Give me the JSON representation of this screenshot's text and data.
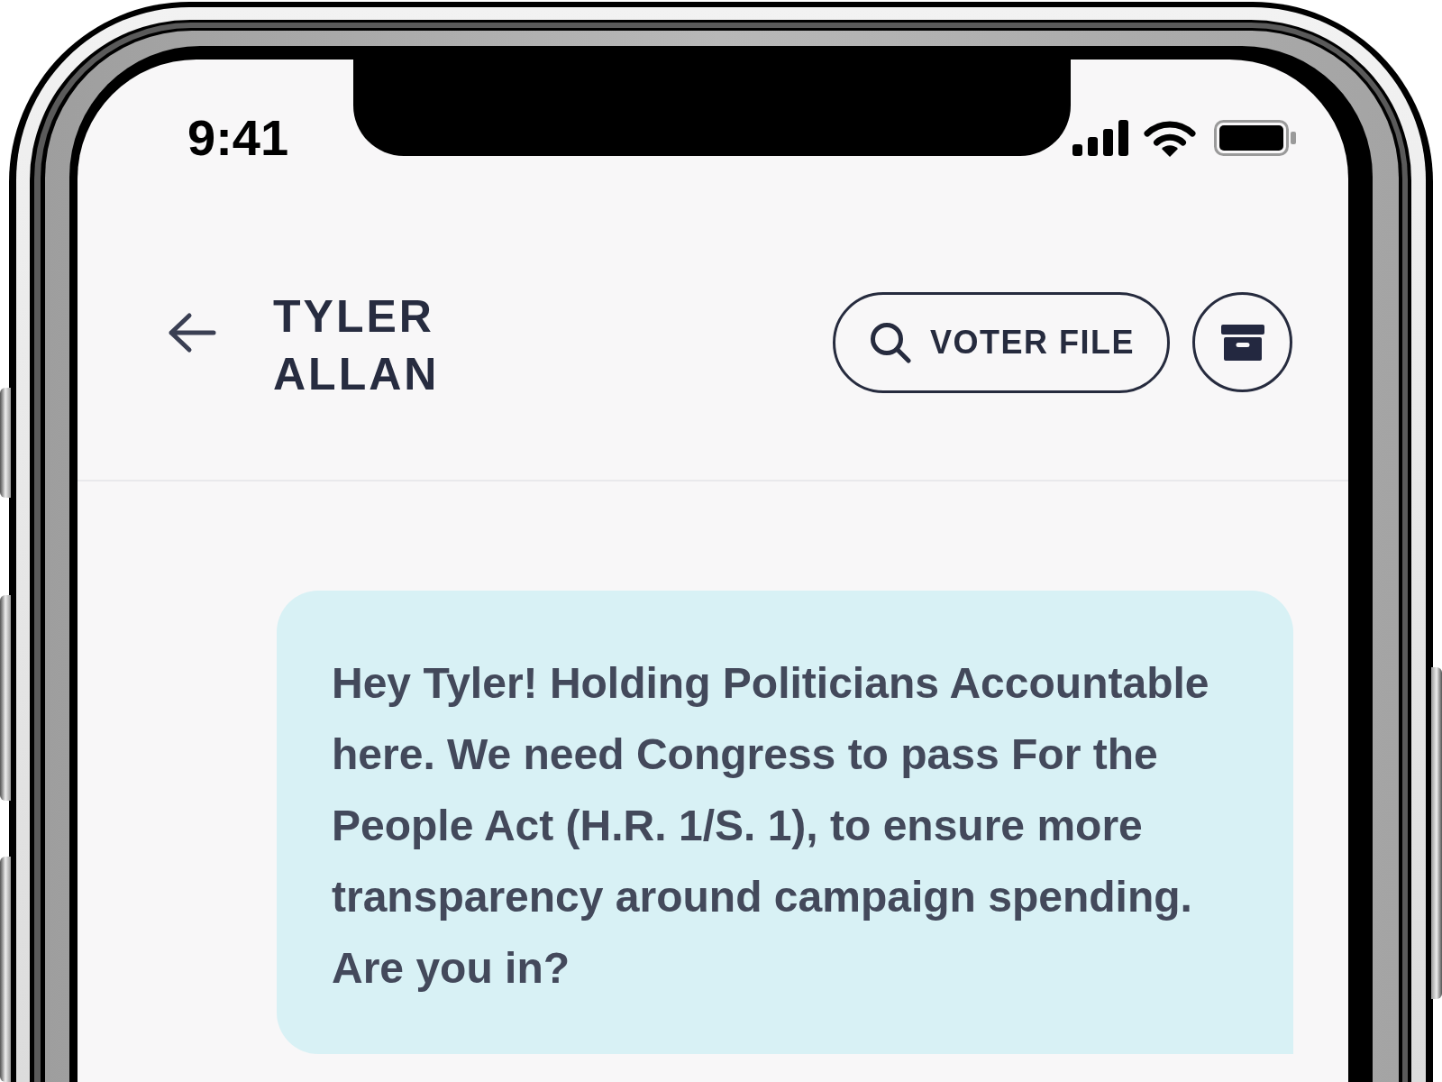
{
  "status_bar": {
    "time": "9:41"
  },
  "header": {
    "contact_name": "TYLER ALLAN",
    "voter_file_button": "VOTER FILE"
  },
  "messages": [
    {
      "kind": "outgoing",
      "text": "Hey Tyler! Holding Politicians Accountable here. We need Congress to pass For the People Act (H.R. 1/S. 1), to ensure more transparency around campaign spending. Are you in?"
    }
  ]
}
